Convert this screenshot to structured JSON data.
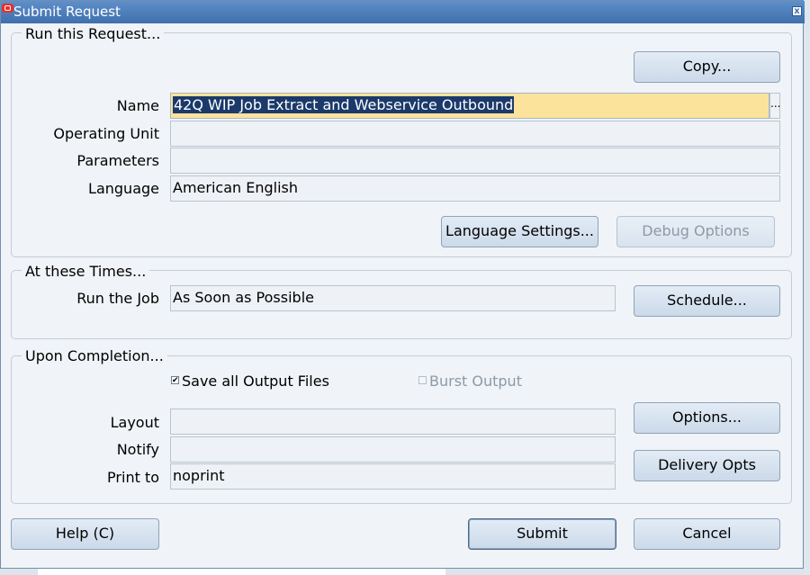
{
  "window": {
    "title": "Submit Request"
  },
  "run_section": {
    "title": "Run this Request...",
    "copy_button": "Copy...",
    "fields": {
      "name": {
        "label": "Name",
        "value": "42Q WIP Job Extract and Webservice Outbound"
      },
      "operating_unit": {
        "label": "Operating Unit",
        "value": ""
      },
      "parameters": {
        "label": "Parameters",
        "value": ""
      },
      "language": {
        "label": "Language",
        "value": "American English"
      }
    },
    "language_settings_button": "Language Settings...",
    "debug_options_button": "Debug Options"
  },
  "times_section": {
    "title": "At these Times...",
    "run_job": {
      "label": "Run the Job",
      "value": "As Soon as Possible"
    },
    "schedule_button": "Schedule..."
  },
  "completion_section": {
    "title": "Upon Completion...",
    "save_output": {
      "label": "Save all Output Files",
      "checked": true
    },
    "burst_output": {
      "label": "Burst Output",
      "checked": false,
      "enabled": false
    },
    "layout": {
      "label": "Layout",
      "value": ""
    },
    "notify": {
      "label": "Notify",
      "value": ""
    },
    "print_to": {
      "label": "Print to",
      "value": "noprint"
    },
    "options_button": "Options...",
    "delivery_button": "Delivery Opts"
  },
  "footer": {
    "help_button": "Help (C)",
    "submit_button": "Submit",
    "cancel_button": "Cancel"
  },
  "icons": {
    "check_mark": "✔",
    "ellipsis": "..."
  }
}
